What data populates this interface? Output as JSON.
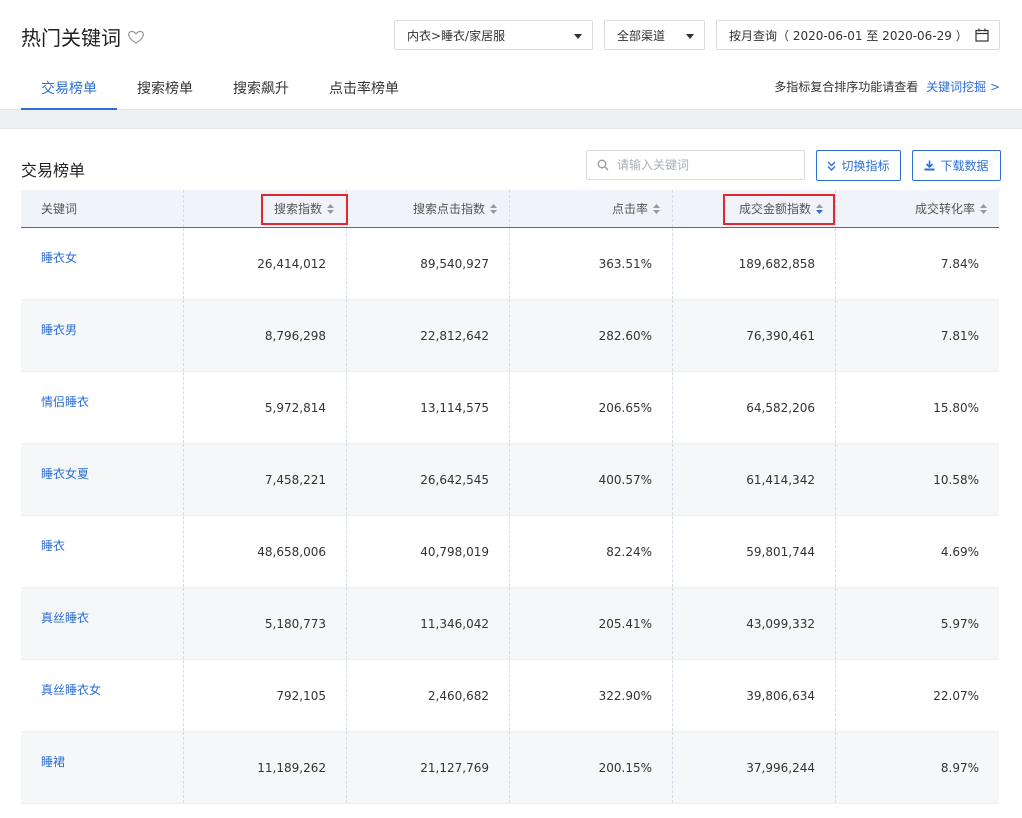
{
  "header": {
    "title": "热门关键词",
    "category_select": "内衣>睡衣/家居服",
    "channel_select": "全部渠道",
    "date_range": "按月查询（ 2020-06-01 至 2020-06-29 ）",
    "tabs": [
      {
        "label": "交易榜单",
        "active": true
      },
      {
        "label": "搜索榜单",
        "active": false
      },
      {
        "label": "搜索飙升",
        "active": false
      },
      {
        "label": "点击率榜单",
        "active": false
      }
    ],
    "hint_text": "多指标复合排序功能请查看",
    "hint_link": "关键词挖掘 >"
  },
  "main": {
    "section_title": "交易榜单",
    "search_placeholder": "请输入关键词",
    "switch_button": "切换指标",
    "download_button": "下载数据"
  },
  "table": {
    "columns": [
      "关键词",
      "搜索指数",
      "搜索点击指数",
      "点击率",
      "成交金额指数",
      "成交转化率"
    ],
    "rows": [
      [
        "睡衣女",
        "26,414,012",
        "89,540,927",
        "363.51%",
        "189,682,858",
        "7.84%"
      ],
      [
        "睡衣男",
        "8,796,298",
        "22,812,642",
        "282.60%",
        "76,390,461",
        "7.81%"
      ],
      [
        "情侣睡衣",
        "5,972,814",
        "13,114,575",
        "206.65%",
        "64,582,206",
        "15.80%"
      ],
      [
        "睡衣女夏",
        "7,458,221",
        "26,642,545",
        "400.57%",
        "61,414,342",
        "10.58%"
      ],
      [
        "睡衣",
        "48,658,006",
        "40,798,019",
        "82.24%",
        "59,801,744",
        "4.69%"
      ],
      [
        "真丝睡衣",
        "5,180,773",
        "11,346,042",
        "205.41%",
        "43,099,332",
        "5.97%"
      ],
      [
        "真丝睡衣女",
        "792,105",
        "2,460,682",
        "322.90%",
        "39,806,634",
        "22.07%"
      ],
      [
        "睡裙",
        "11,189,262",
        "21,127,769",
        "200.15%",
        "37,996,244",
        "8.97%"
      ]
    ]
  },
  "colors": {
    "accent": "#2d6fd2",
    "highlight": "#e3262f"
  }
}
